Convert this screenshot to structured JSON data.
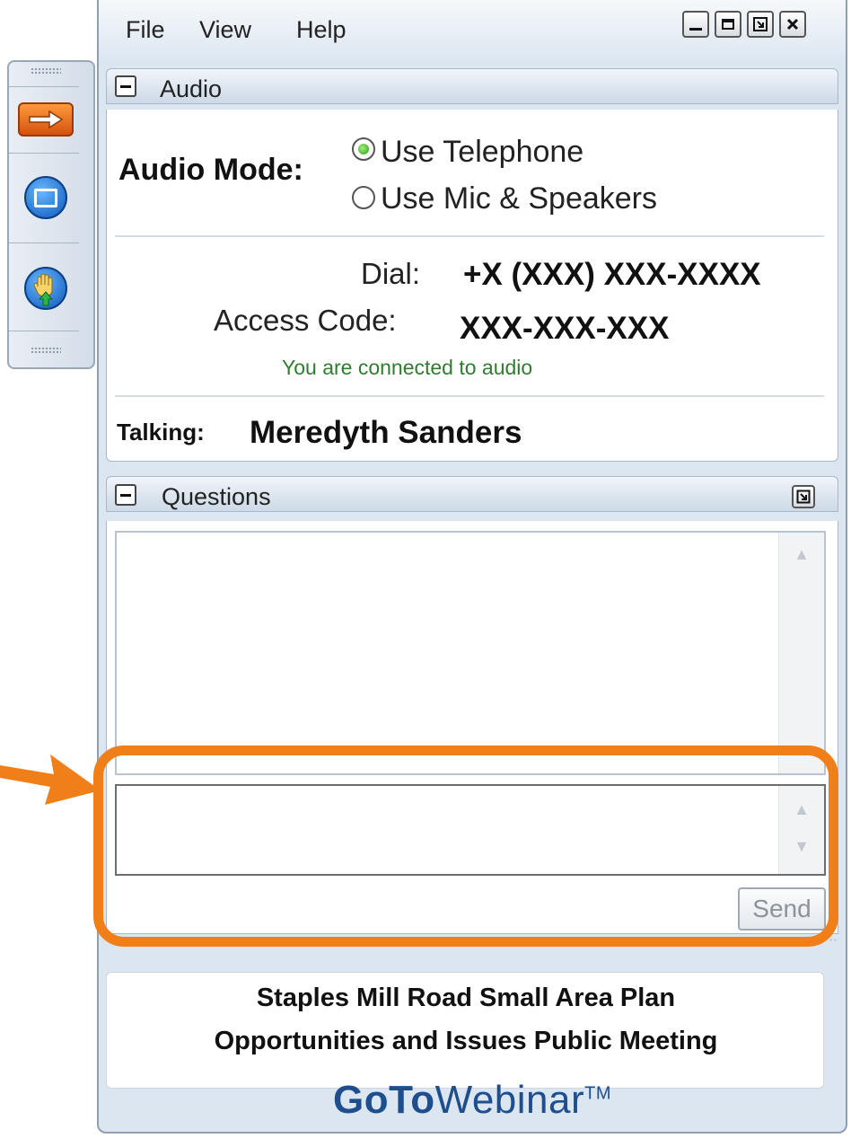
{
  "menu": {
    "file": "File",
    "view": "View",
    "help": "Help"
  },
  "audio": {
    "panel_title": "Audio",
    "mode_label": "Audio Mode:",
    "options": [
      "Use Telephone",
      "Use Mic & Speakers"
    ],
    "selected_option": "Use Telephone",
    "dial_label": "Dial:",
    "dial_value": "+X (XXX) XXX-XXXX",
    "access_label": "Access Code:",
    "access_value": "XXX-XXX-XXX",
    "status": "You are connected to audio",
    "talking_label": "Talking:",
    "talking_name": "Meredyth Sanders"
  },
  "questions": {
    "panel_title": "Questions",
    "send_label": "Send",
    "input_value": ""
  },
  "meeting": {
    "line1": "Staples Mill Road Small Area Plan",
    "line2": "Opportunities and Issues Public Meeting"
  },
  "brand": {
    "go_to": "GoTo",
    "webinar": "Webinar",
    "tm": "TM"
  },
  "colors": {
    "highlight": "#f07f1a",
    "status_text": "#2f7d2f",
    "brand_blue": "#1e4f8c",
    "window_bg": "#dbe6f1"
  },
  "icons": {
    "toolbar": [
      "arrow-right-icon",
      "screen-icon",
      "raise-hand-icon"
    ],
    "window": [
      "minimize-icon",
      "maximize-icon",
      "restore-icon",
      "close-icon"
    ]
  }
}
